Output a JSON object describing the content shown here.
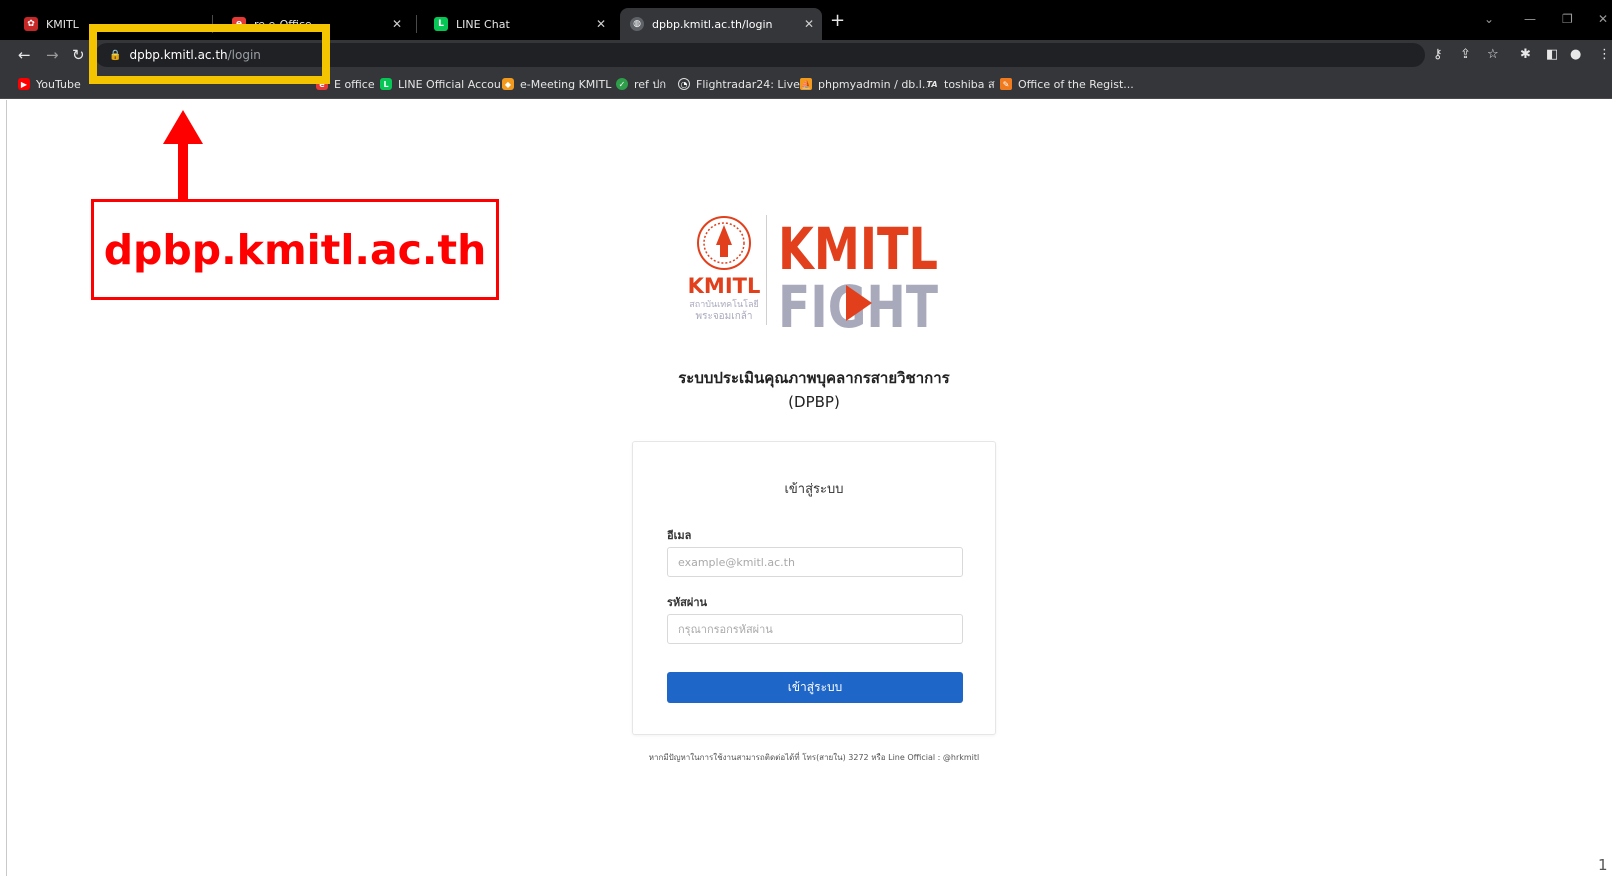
{
  "browser": {
    "tabs": [
      {
        "label": "KMITL",
        "active": false
      },
      {
        "label": "re e-Office",
        "active": false
      },
      {
        "label": "LINE Chat",
        "active": false
      },
      {
        "label": "dpbp.kmitl.ac.th/login",
        "active": true
      }
    ],
    "address": {
      "host": "dpbp.kmitl.ac.th",
      "path": "/login"
    },
    "bookmarks": [
      {
        "label": "YouTube"
      },
      {
        "label": "E office"
      },
      {
        "label": "LINE Official Accou..."
      },
      {
        "label": "e-Meeting KMITL"
      },
      {
        "label": "ref ปก"
      },
      {
        "label": "Flightradar24: Live..."
      },
      {
        "label": "phpmyadmin / db.l..."
      },
      {
        "label": "toshiba ส"
      },
      {
        "label": "Office of the Regist..."
      }
    ]
  },
  "page": {
    "logo": {
      "seal_text": "KMITL",
      "thai_line1": "สถาบันเทคโนโลยี",
      "thai_line2": "พระจอมเกล้า",
      "brand_top": "KMITL",
      "brand_bottom": "FIGHT"
    },
    "system_title": "ระบบประเมินคุณภาพบุคลากรสายวิชาการ",
    "system_subtitle": "(DPBP)",
    "login": {
      "title": "เข้าสู่ระบบ",
      "email_label": "อีเมล",
      "email_placeholder": "example@kmitl.ac.th",
      "password_label": "รหัสผ่าน",
      "password_placeholder": "กรุณากรอกรหัสผ่าน",
      "submit_label": "เข้าสู่ระบบ"
    },
    "help_text": "หากมีปัญหาในการใช้งานสามารถติดต่อได้ที่ โทร(สายใน) 3272 หรือ Line Official : @hrkmitl",
    "page_number": "1"
  },
  "annotation": {
    "label": "dpbp.kmitl.ac.th"
  },
  "colors": {
    "accent": "#1f66c9",
    "annotation_red": "#ff0000",
    "annotation_yellow": "#f5c400",
    "brand_orange": "#e2401c",
    "brand_grey": "#a9a9bc"
  }
}
